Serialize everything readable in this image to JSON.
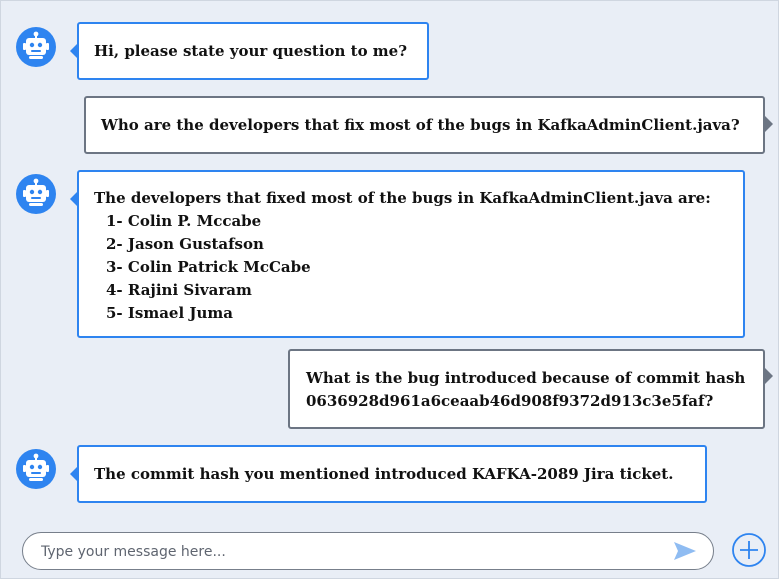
{
  "colors": {
    "accent": "#2e84f0",
    "user_border": "#6c7583",
    "background": "#e9eef6"
  },
  "messages": [
    {
      "role": "bot",
      "text": "Hi, please state your question to me?"
    },
    {
      "role": "user",
      "text": "Who are the developers that fix most of the bugs in KafkaAdminClient.java?"
    },
    {
      "role": "bot",
      "text": "The developers that fixed most of the bugs in KafkaAdminClient.java are:",
      "list": [
        "1- Colin P. Mccabe",
        "2- Jason Gustafson",
        "3- Colin Patrick McCabe",
        "4- Rajini Sivaram",
        "5- Ismael Juma"
      ]
    },
    {
      "role": "user",
      "lines": [
        "What is the bug introduced because of commit hash",
        "0636928d961a6ceaab46d908f9372d913c3e5faf?"
      ]
    },
    {
      "role": "bot",
      "text": "The commit hash you mentioned introduced KAFKA-2089 Jira ticket."
    }
  ],
  "composer": {
    "placeholder": "Type your message here...",
    "value": "",
    "send_icon": "send-arrow-icon",
    "add_icon": "plus-circle-icon"
  },
  "icons": {
    "bot_avatar": "robot-icon"
  }
}
